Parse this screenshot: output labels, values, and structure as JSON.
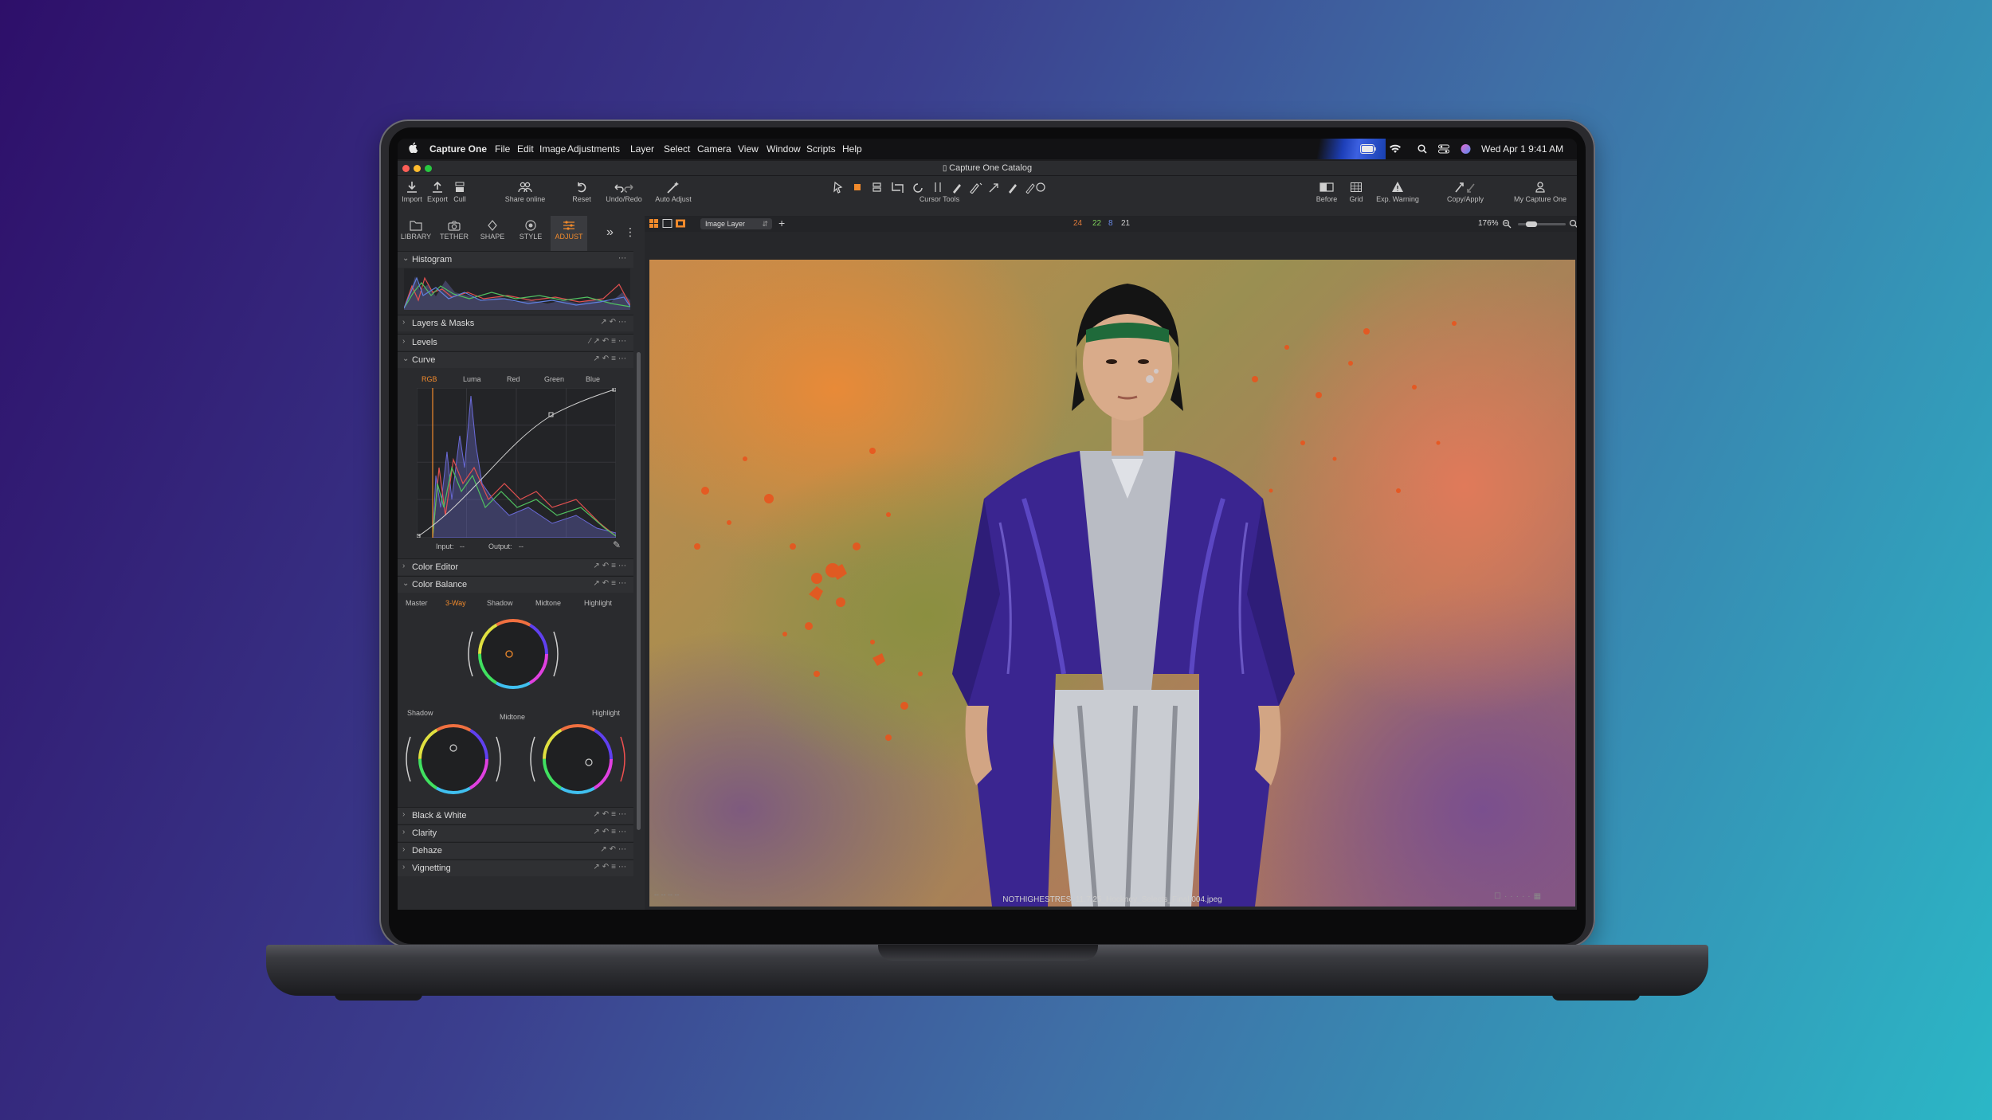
{
  "menubar": {
    "app_name": "Capture One",
    "items": [
      "File",
      "Edit",
      "Image",
      "Adjustments",
      "Layer",
      "Select",
      "Camera",
      "View",
      "Window",
      "Scripts",
      "Help"
    ],
    "clock": "Wed Apr 1  9:41 AM"
  },
  "window": {
    "title": "Capture One Catalog"
  },
  "toolbar": {
    "import": "Import",
    "export": "Export",
    "cull": "Cull",
    "share_online": "Share online",
    "reset": "Reset",
    "undo_redo": "Undo/Redo",
    "auto_adjust": "Auto Adjust",
    "cursor_tools": "Cursor Tools",
    "before": "Before",
    "grid": "Grid",
    "exp_warning": "Exp. Warning",
    "copy_apply": "Copy/Apply",
    "my_capture_one": "My Capture One"
  },
  "tool_tabs": [
    {
      "label": "LIBRARY"
    },
    {
      "label": "TETHER"
    },
    {
      "label": "SHAPE"
    },
    {
      "label": "STYLE"
    },
    {
      "label": "ADJUST",
      "active": true
    }
  ],
  "viewer_bar": {
    "layer_select": "Image Layer",
    "counts": [
      "24",
      "22",
      "8",
      "21"
    ],
    "zoom": "176%"
  },
  "panels": {
    "histogram": "Histogram",
    "layers_masks": "Layers & Masks",
    "levels": "Levels",
    "curve": "Curve",
    "curve_tabs": [
      "RGB",
      "Luma",
      "Red",
      "Green",
      "Blue"
    ],
    "curve_input": "Input:",
    "curve_input_val": "--",
    "curve_output": "Output:",
    "curve_output_val": "--",
    "color_editor": "Color Editor",
    "color_balance": "Color Balance",
    "cb_tabs": [
      "Master",
      "3-Way",
      "Shadow",
      "Midtone",
      "Highlight"
    ],
    "wheel_shadow": "Shadow",
    "wheel_midtone": "Midtone",
    "wheel_highlight": "Highlight",
    "black_white": "Black & White",
    "clarity": "Clarity",
    "dehaze": "Dehaze",
    "vignetting": "Vignetting"
  },
  "viewer": {
    "filename": "NOTHIGHESTRES_11.7.25_Hockney_Selects_Final.004.jpeg",
    "left_placeholder": "--   --   --   --"
  },
  "colors": {
    "accent": "#f08a2c",
    "count1": "#e07a3a",
    "count2": "#7ed05a",
    "count3": "#6a8ae8",
    "count4": "#d0d0d0"
  }
}
